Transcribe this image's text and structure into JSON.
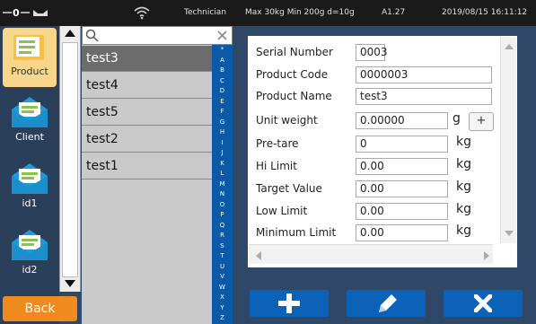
{
  "status_bar": {
    "user_role": "Technician",
    "scale_info": "Max 30kg  Min 200g  d=10g",
    "version": "A1.27",
    "datetime": "2019/08/15  16:11:12"
  },
  "nav": {
    "items": [
      {
        "label": "Product",
        "icon": "product-doc-icon",
        "active": true
      },
      {
        "label": "Client",
        "icon": "client-envelope-icon",
        "active": false
      },
      {
        "label": "id1",
        "icon": "id-envelope-icon",
        "active": false
      },
      {
        "label": "id2",
        "icon": "id-envelope-icon",
        "active": false
      }
    ],
    "back_label": "Back"
  },
  "search": {
    "placeholder": ""
  },
  "list": {
    "items": [
      "test3",
      "test4",
      "test5",
      "test2",
      "test1"
    ],
    "selected": "test3"
  },
  "alphabet": [
    "*",
    "A",
    "B",
    "C",
    "D",
    "E",
    "F",
    "G",
    "H",
    "I",
    "J",
    "K",
    "L",
    "M",
    "N",
    "O",
    "P",
    "Q",
    "R",
    "S",
    "T",
    "U",
    "V",
    "W",
    "X",
    "Y",
    "Z"
  ],
  "details": {
    "fields": [
      {
        "label": "Serial Number",
        "value": "0003",
        "unit": ""
      },
      {
        "label": "Product Code",
        "value": "0000003",
        "unit": ""
      },
      {
        "label": "Product Name",
        "value": "test3",
        "unit": ""
      },
      {
        "label": "Unit weight",
        "value": "0.00000",
        "unit": "g"
      },
      {
        "label": "Pre-tare",
        "value": "0",
        "unit": "kg"
      },
      {
        "label": "Hi Limit",
        "value": "0.00",
        "unit": "kg"
      },
      {
        "label": "Target Value",
        "value": "0.00",
        "unit": "kg"
      },
      {
        "label": "Low Limit",
        "value": "0.00",
        "unit": "kg"
      },
      {
        "label": "Minimum Limit",
        "value": "0.00",
        "unit": "kg"
      }
    ],
    "unit_weight_plus": "+"
  },
  "actions": [
    {
      "name": "add",
      "icon": "plus-icon"
    },
    {
      "name": "edit",
      "icon": "pencil-icon"
    },
    {
      "name": "delete",
      "icon": "close-icon"
    }
  ],
  "colors": {
    "accent_blue": "#0b62b8",
    "back_orange": "#f18a1e",
    "active_nav": "#f7d58a",
    "selected_row": "#6c6c6c"
  }
}
